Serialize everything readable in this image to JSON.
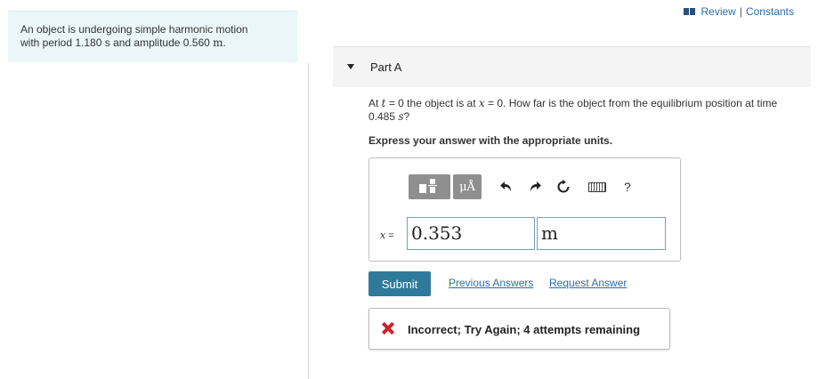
{
  "problem": {
    "line1": "An object is undergoing simple harmonic motion",
    "line2_prefix": "with period 1.180 s and amplitude 0.560 ",
    "line2_unit": "m",
    "line2_suffix": "."
  },
  "toplinks": {
    "review": "Review",
    "separator": "|",
    "constants": "Constants"
  },
  "part": {
    "title": "Part A"
  },
  "question": {
    "t1": "At ",
    "t_var": "t",
    "t2": " = 0 the object is at ",
    "x_var": "x",
    "t3": " = 0. How far is the object from the equilibrium position at time 0.485 ",
    "s_var": "s",
    "t4": "?"
  },
  "instruction": "Express your answer with the appropriate units.",
  "toolbar": {
    "units_label": "μÅ",
    "help_label": "?"
  },
  "answer": {
    "var": "x",
    "equals": " =",
    "value": "0.353",
    "unit": "m"
  },
  "actions": {
    "submit": "Submit",
    "previous": "Previous Answers",
    "request": "Request Answer"
  },
  "feedback": {
    "message": "Incorrect; Try Again; 4 attempts remaining"
  },
  "colors": {
    "accent": "#2f7a9a",
    "link": "#2a6fb0",
    "error": "#d0202a",
    "panel": "#eaf6f7"
  }
}
